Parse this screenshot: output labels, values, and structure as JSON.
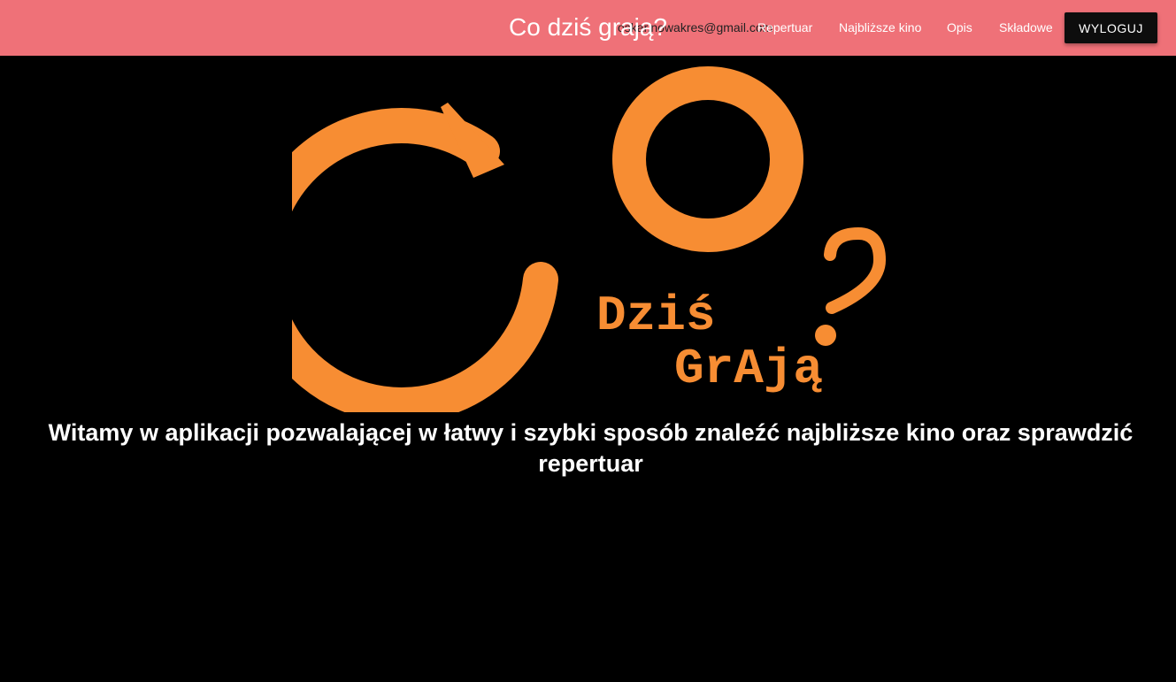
{
  "navbar": {
    "brand": "Co dziś grają?",
    "user_email": "oskar.nowakres@gmail.com",
    "links": [
      "Repertuar",
      "Najbliższe kino",
      "Opis",
      "Składowe"
    ],
    "logout_label": "WYLOGUJ",
    "background_color": "#ef7178"
  },
  "logo": {
    "wordmark_line1": "Dziś",
    "wordmark_line2": "GrAją",
    "accent_color": "#f78d33"
  },
  "main": {
    "welcome_text": "Witamy w aplikacji pozwalającej w łatwy i szybki sposób znaleźć najbliższe kino oraz sprawdzić repertuar"
  }
}
